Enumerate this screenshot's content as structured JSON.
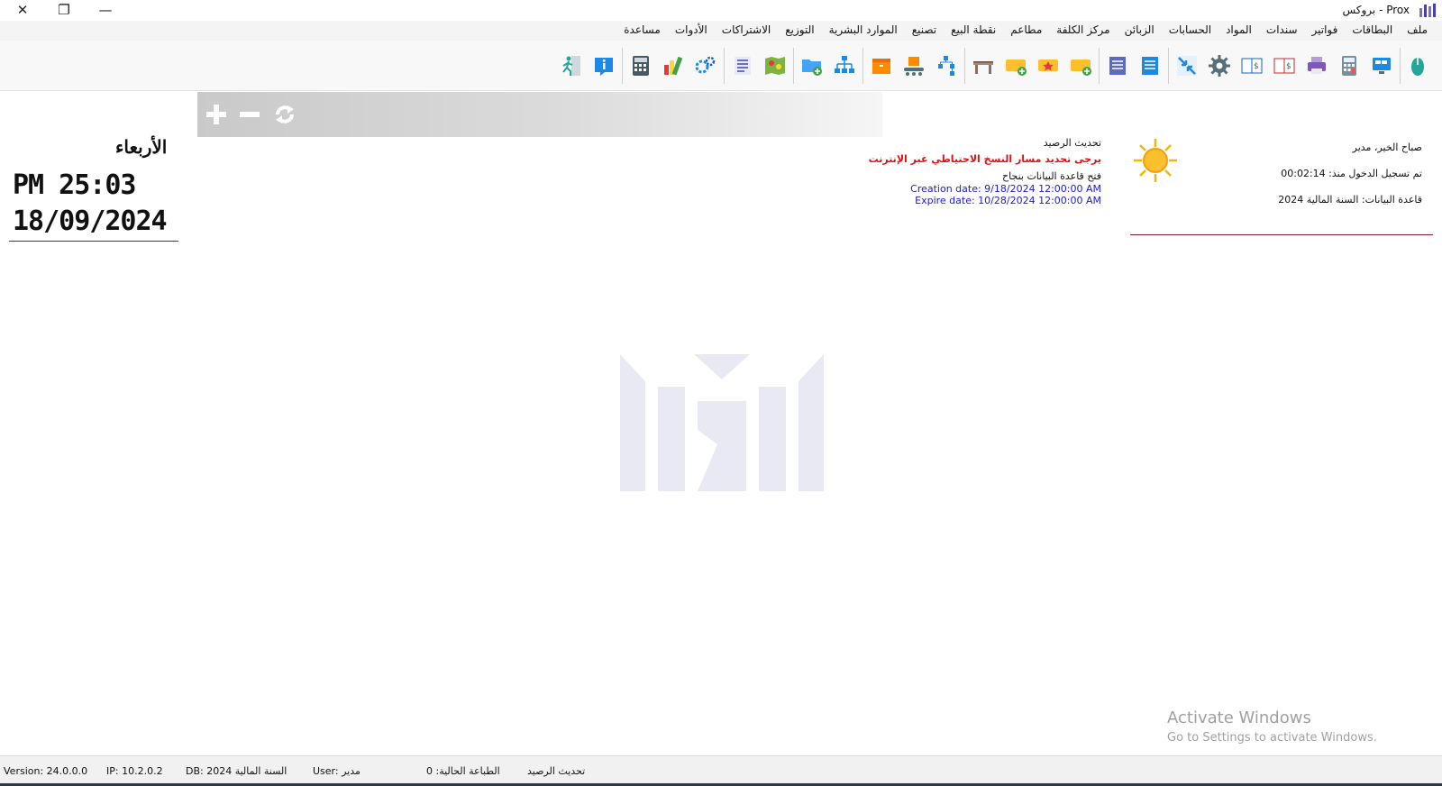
{
  "window": {
    "title": "Prox - بروكس",
    "controls": {
      "close": "✕",
      "restore": "❐",
      "minimize": "—"
    }
  },
  "menu": [
    "ملف",
    "البطاقات",
    "فواتير",
    "سندات",
    "المواد",
    "الحسابات",
    "الزبائن",
    "مركز الكلفة",
    "مطاعم",
    "نقطة البيع",
    "تصنيع",
    "الموارد البشرية",
    "التوزيع",
    "الاشتراكات",
    "الأدوات",
    "مساعدة"
  ],
  "toolbar_groups": [
    [
      "mouse-icon"
    ],
    [
      "monitor-icon",
      "calculator-icon",
      "printer-icon",
      "ledger-red-icon",
      "ledger-blue-icon",
      "gear-icon",
      "arrows-icon"
    ],
    [
      "list-blue-icon",
      "list-purple-icon"
    ],
    [
      "ticket-add-icon",
      "ticket-star-icon",
      "ticket-add-icon-2",
      "table-icon"
    ],
    [
      "tree-icon",
      "conveyor-icon",
      "box-icon"
    ],
    [
      "hierarchy-icon",
      "folder-add-icon"
    ],
    [
      "map-icon",
      "document-list-icon"
    ],
    [
      "cogs-icon",
      "colors-icon",
      "calc-grid-icon"
    ],
    [
      "info-icon",
      "exit-icon"
    ]
  ],
  "zoom": {
    "plus": "+",
    "minus": "−",
    "refresh": "⟳"
  },
  "clock": {
    "day": "الأربعاء",
    "time": "PM 25:03",
    "date": "18/09/2024"
  },
  "messages": {
    "update_balance": "تحديث الرصيد",
    "backup_warning": "يرجى تحديد مسار النسخ الاحتياطي عبر الإنترنت",
    "db_opened": "فتح قاعدة البيانات بنجاح",
    "creation_date": "Creation date: 9/18/2024 12:00:00 AM",
    "expire_date": "Expire date: 10/28/2024 12:00:00 AM"
  },
  "greeting": {
    "hello": "صباح الخير، مدير",
    "login": "تم تسجيل الدخول منذ: 00:02:14",
    "database": "قاعدة البيانات: السنة المالية 2024"
  },
  "activation": {
    "title": "Activate Windows",
    "subtitle": "Go to Settings to activate Windows."
  },
  "status": {
    "version": "Version: 24.0.0.0",
    "ip": "IP: 10.2.0.2",
    "db": "DB: 2024 السنة المالية",
    "user": "User: مدير",
    "printing": "الطباعة الحالية: 0",
    "refresh": "تحديث الرصيد"
  },
  "colors": {
    "warning": "#e01010",
    "info_blue": "#1a1ad0",
    "separator_line": "#7a1b2a",
    "status_bottom": "#2b3a44"
  }
}
